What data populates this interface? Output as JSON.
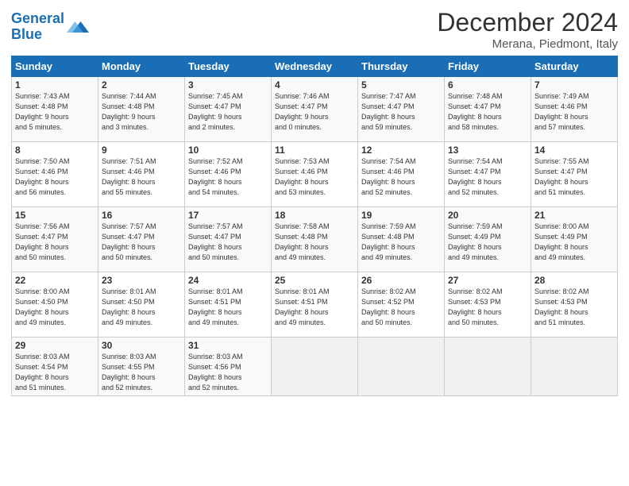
{
  "header": {
    "logo_text_general": "General",
    "logo_text_blue": "Blue",
    "month": "December 2024",
    "location": "Merana, Piedmont, Italy"
  },
  "days_of_week": [
    "Sunday",
    "Monday",
    "Tuesday",
    "Wednesday",
    "Thursday",
    "Friday",
    "Saturday"
  ],
  "weeks": [
    [
      {
        "day": "1",
        "info": "Sunrise: 7:43 AM\nSunset: 4:48 PM\nDaylight: 9 hours\nand 5 minutes."
      },
      {
        "day": "2",
        "info": "Sunrise: 7:44 AM\nSunset: 4:48 PM\nDaylight: 9 hours\nand 3 minutes."
      },
      {
        "day": "3",
        "info": "Sunrise: 7:45 AM\nSunset: 4:47 PM\nDaylight: 9 hours\nand 2 minutes."
      },
      {
        "day": "4",
        "info": "Sunrise: 7:46 AM\nSunset: 4:47 PM\nDaylight: 9 hours\nand 0 minutes."
      },
      {
        "day": "5",
        "info": "Sunrise: 7:47 AM\nSunset: 4:47 PM\nDaylight: 8 hours\nand 59 minutes."
      },
      {
        "day": "6",
        "info": "Sunrise: 7:48 AM\nSunset: 4:47 PM\nDaylight: 8 hours\nand 58 minutes."
      },
      {
        "day": "7",
        "info": "Sunrise: 7:49 AM\nSunset: 4:46 PM\nDaylight: 8 hours\nand 57 minutes."
      }
    ],
    [
      {
        "day": "8",
        "info": "Sunrise: 7:50 AM\nSunset: 4:46 PM\nDaylight: 8 hours\nand 56 minutes."
      },
      {
        "day": "9",
        "info": "Sunrise: 7:51 AM\nSunset: 4:46 PM\nDaylight: 8 hours\nand 55 minutes."
      },
      {
        "day": "10",
        "info": "Sunrise: 7:52 AM\nSunset: 4:46 PM\nDaylight: 8 hours\nand 54 minutes."
      },
      {
        "day": "11",
        "info": "Sunrise: 7:53 AM\nSunset: 4:46 PM\nDaylight: 8 hours\nand 53 minutes."
      },
      {
        "day": "12",
        "info": "Sunrise: 7:54 AM\nSunset: 4:46 PM\nDaylight: 8 hours\nand 52 minutes."
      },
      {
        "day": "13",
        "info": "Sunrise: 7:54 AM\nSunset: 4:47 PM\nDaylight: 8 hours\nand 52 minutes."
      },
      {
        "day": "14",
        "info": "Sunrise: 7:55 AM\nSunset: 4:47 PM\nDaylight: 8 hours\nand 51 minutes."
      }
    ],
    [
      {
        "day": "15",
        "info": "Sunrise: 7:56 AM\nSunset: 4:47 PM\nDaylight: 8 hours\nand 50 minutes."
      },
      {
        "day": "16",
        "info": "Sunrise: 7:57 AM\nSunset: 4:47 PM\nDaylight: 8 hours\nand 50 minutes."
      },
      {
        "day": "17",
        "info": "Sunrise: 7:57 AM\nSunset: 4:47 PM\nDaylight: 8 hours\nand 50 minutes."
      },
      {
        "day": "18",
        "info": "Sunrise: 7:58 AM\nSunset: 4:48 PM\nDaylight: 8 hours\nand 49 minutes."
      },
      {
        "day": "19",
        "info": "Sunrise: 7:59 AM\nSunset: 4:48 PM\nDaylight: 8 hours\nand 49 minutes."
      },
      {
        "day": "20",
        "info": "Sunrise: 7:59 AM\nSunset: 4:49 PM\nDaylight: 8 hours\nand 49 minutes."
      },
      {
        "day": "21",
        "info": "Sunrise: 8:00 AM\nSunset: 4:49 PM\nDaylight: 8 hours\nand 49 minutes."
      }
    ],
    [
      {
        "day": "22",
        "info": "Sunrise: 8:00 AM\nSunset: 4:50 PM\nDaylight: 8 hours\nand 49 minutes."
      },
      {
        "day": "23",
        "info": "Sunrise: 8:01 AM\nSunset: 4:50 PM\nDaylight: 8 hours\nand 49 minutes."
      },
      {
        "day": "24",
        "info": "Sunrise: 8:01 AM\nSunset: 4:51 PM\nDaylight: 8 hours\nand 49 minutes."
      },
      {
        "day": "25",
        "info": "Sunrise: 8:01 AM\nSunset: 4:51 PM\nDaylight: 8 hours\nand 49 minutes."
      },
      {
        "day": "26",
        "info": "Sunrise: 8:02 AM\nSunset: 4:52 PM\nDaylight: 8 hours\nand 50 minutes."
      },
      {
        "day": "27",
        "info": "Sunrise: 8:02 AM\nSunset: 4:53 PM\nDaylight: 8 hours\nand 50 minutes."
      },
      {
        "day": "28",
        "info": "Sunrise: 8:02 AM\nSunset: 4:53 PM\nDaylight: 8 hours\nand 51 minutes."
      }
    ],
    [
      {
        "day": "29",
        "info": "Sunrise: 8:03 AM\nSunset: 4:54 PM\nDaylight: 8 hours\nand 51 minutes."
      },
      {
        "day": "30",
        "info": "Sunrise: 8:03 AM\nSunset: 4:55 PM\nDaylight: 8 hours\nand 52 minutes."
      },
      {
        "day": "31",
        "info": "Sunrise: 8:03 AM\nSunset: 4:56 PM\nDaylight: 8 hours\nand 52 minutes."
      },
      {
        "day": "",
        "info": ""
      },
      {
        "day": "",
        "info": ""
      },
      {
        "day": "",
        "info": ""
      },
      {
        "day": "",
        "info": ""
      }
    ]
  ]
}
